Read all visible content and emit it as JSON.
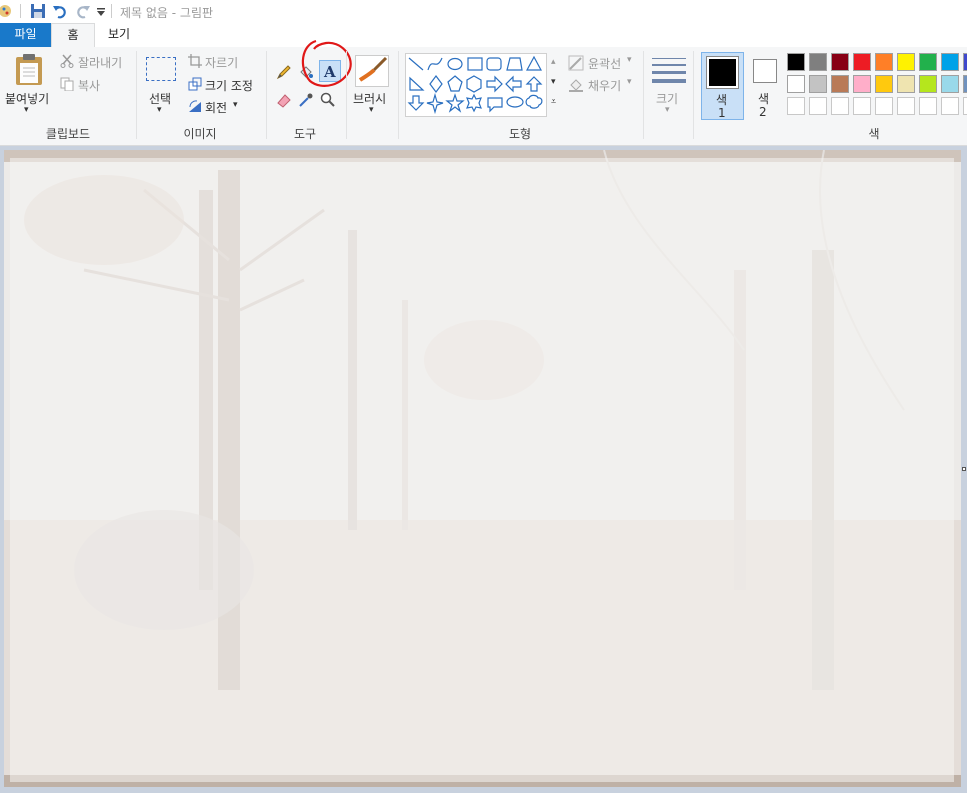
{
  "window": {
    "title": "제목 없음 - 그림판"
  },
  "tabs": [
    {
      "label": "파일"
    },
    {
      "label": "홈"
    },
    {
      "label": "보기"
    }
  ],
  "clipboard": {
    "paste": "붙여넣기",
    "cut": "잘라내기",
    "copy": "복사",
    "group": "클립보드"
  },
  "image": {
    "select": "선택",
    "crop": "자르기",
    "resize": "크기 조정",
    "rotate": "회전",
    "group": "이미지"
  },
  "tools": {
    "group": "도구"
  },
  "brushes": {
    "label": "브러시"
  },
  "shapes": {
    "outline": "윤곽선",
    "fill": "채우기",
    "group": "도형"
  },
  "size": {
    "label": "크기"
  },
  "colors": {
    "color1": "색\n1",
    "color1_line1": "색",
    "color1_line2": "1",
    "color2_line1": "색",
    "color2_line2": "2",
    "group": "색",
    "row1": [
      "#000000",
      "#7f7f7f",
      "#880015",
      "#ed1c24",
      "#ff7f27",
      "#fff200",
      "#22b14c",
      "#00a2e8",
      "#3f48cc"
    ],
    "row2": [
      "#ffffff",
      "#c3c3c3",
      "#b97a57",
      "#ffaec9",
      "#ffc90e",
      "#efe4b0",
      "#b5e61d",
      "#99d9ea",
      "#7092be"
    ],
    "row3": [
      "#ffffff",
      "#ffffff",
      "#ffffff",
      "#ffffff",
      "#ffffff",
      "#ffffff",
      "#ffffff",
      "#ffffff",
      "#ffffff"
    ],
    "selected_color1": "#000000",
    "selected_color2": "#ffffff"
  }
}
